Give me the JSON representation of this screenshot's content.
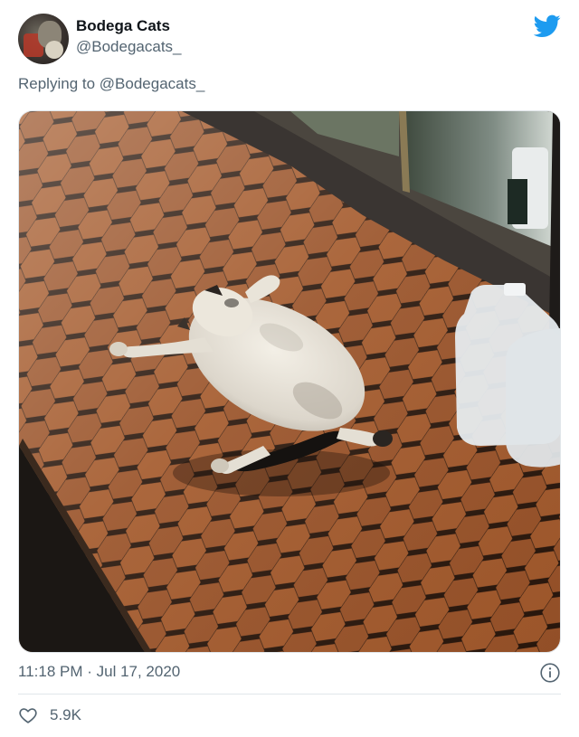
{
  "tweet": {
    "author_name": "Bodega Cats",
    "author_handle": "@Bodegacats_",
    "reply_prefix": "Replying to",
    "reply_to": "@Bodegacats_",
    "timestamp": "11:18 PM · Jul 17, 2020",
    "like_count": "5.9K"
  },
  "colors": {
    "twitter_blue": "#1d9bf0",
    "muted_text": "#536471",
    "divider": "#e1e6ea"
  },
  "icons": {
    "brand": "twitter-bird-icon",
    "info": "info-icon",
    "like": "heart-icon"
  }
}
